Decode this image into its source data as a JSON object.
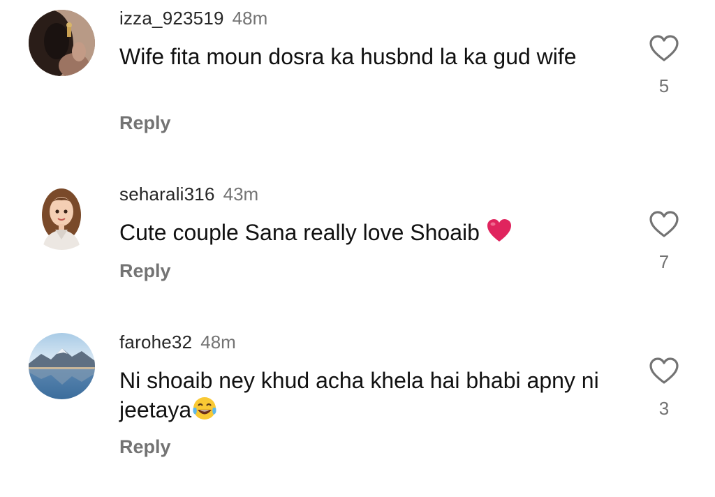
{
  "comments": [
    {
      "username": "izza_923519",
      "time": "48m",
      "text": "Wife fita moun dosra ka husbnd la ka gud wife",
      "reply": "Reply",
      "likes": "5",
      "avatar_icon": "woman-photo-avatar"
    },
    {
      "username": "seharali316",
      "time": "43m",
      "text": "Cute couple Sana really love Shoaib",
      "emoji": "red-heart-emoji",
      "reply": "Reply",
      "likes": "7",
      "avatar_icon": "cartoon-girl-avatar"
    },
    {
      "username": "farohe32",
      "time": "48m",
      "text": "Ni shoaib ney khud acha khela hai bhabi apny ni jeetaya",
      "emoji": "tears-of-joy-emoji",
      "reply": "Reply",
      "likes": "3",
      "avatar_icon": "mountain-lake-avatar"
    }
  ],
  "colors": {
    "secondary_text": "#737373",
    "primary_text": "#111111",
    "heart_red": "#e0245e"
  }
}
